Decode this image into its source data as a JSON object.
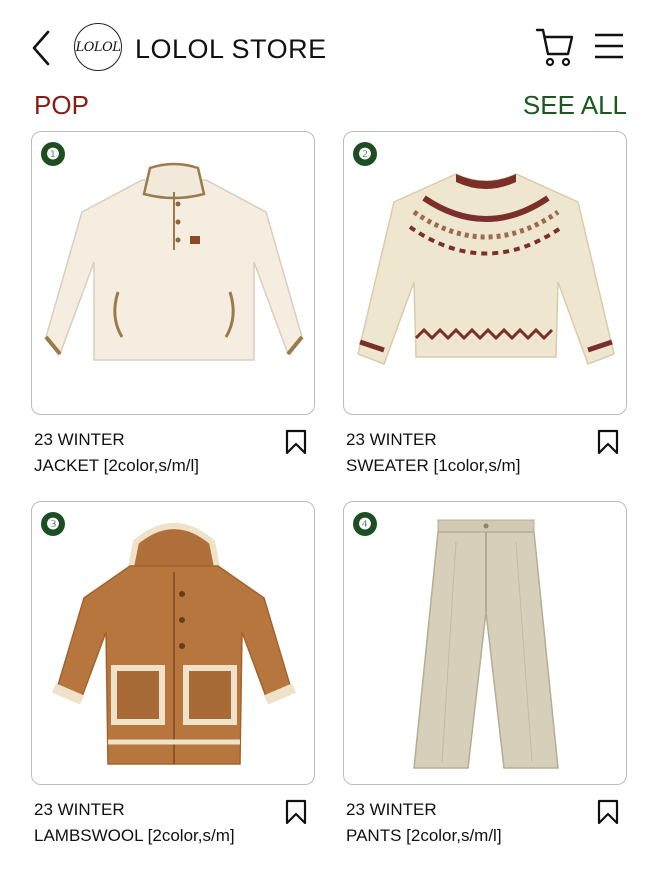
{
  "header": {
    "store_name": "LOLOL STORE",
    "logo_text": "LOLOL",
    "back_icon": "chevron-left-icon",
    "cart_icon": "cart-icon",
    "menu_icon": "hamburger-menu-icon"
  },
  "section": {
    "title": "POP",
    "see_all": "SEE ALL",
    "title_color": "#8a1a13",
    "link_color": "#1a5a1f"
  },
  "products": [
    {
      "rank": "❶",
      "season": "23 WINTER",
      "name": "JACKET [2color,s/m/l]",
      "image": "cream-fleece-jacket"
    },
    {
      "rank": "❷",
      "season": "23 WINTER",
      "name": "SWEATER [1color,s/m]",
      "image": "fair-isle-sweater"
    },
    {
      "rank": "❸",
      "season": "23 WINTER",
      "name": "LAMBSWOOL [2color,s/m]",
      "image": "brown-shearling-coat"
    },
    {
      "rank": "❹",
      "season": "23 WINTER",
      "name": "PANTS [2color,s/m/l]",
      "image": "beige-corduroy-pants"
    }
  ]
}
